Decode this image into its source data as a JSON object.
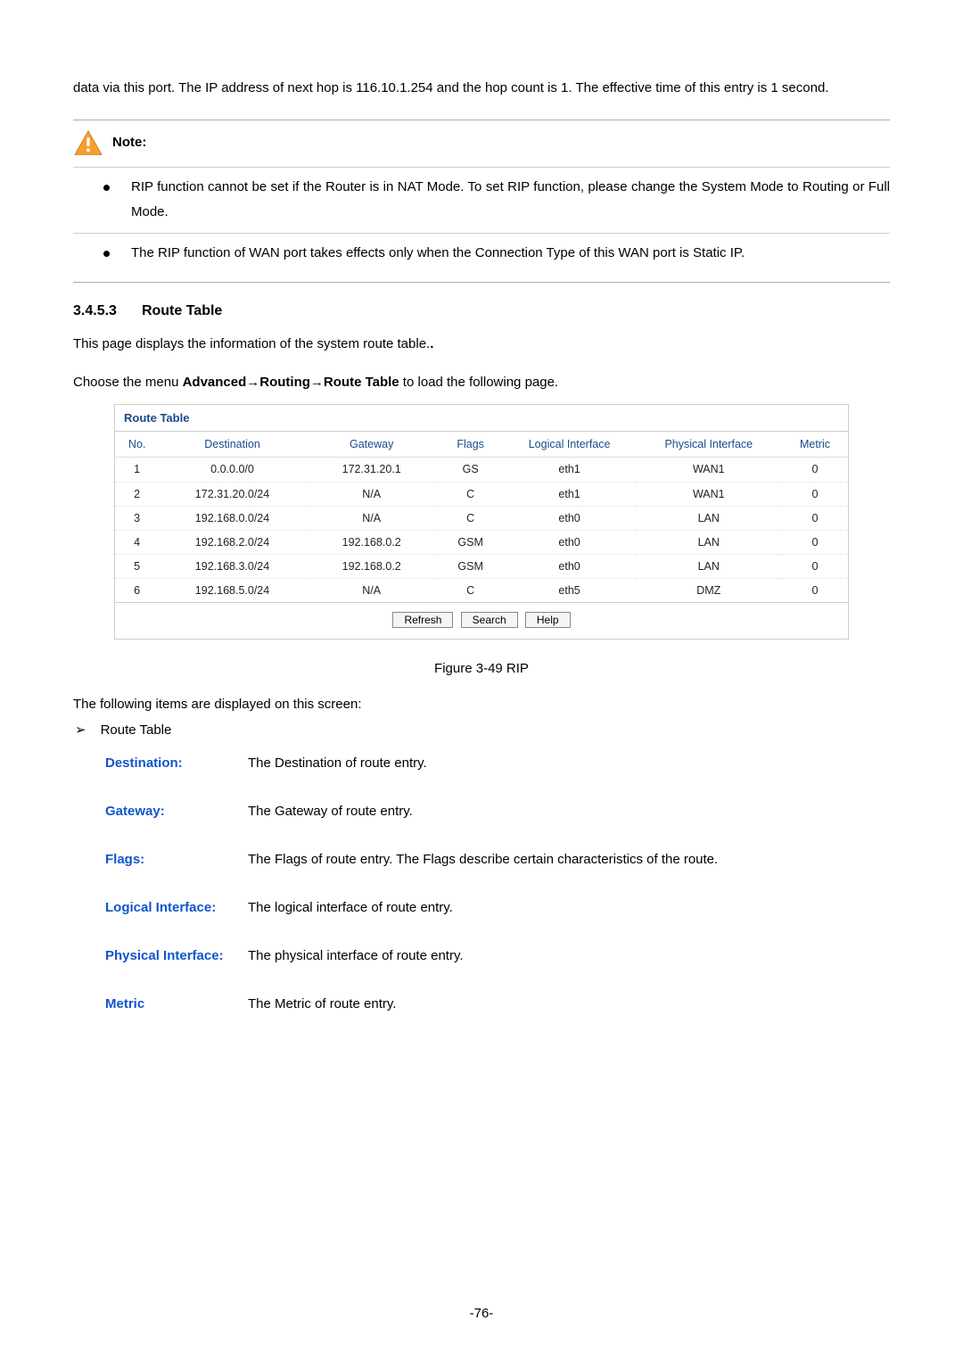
{
  "intro": "data via this port. The IP address of next hop is 116.10.1.254 and the hop count is 1. The effective time of this entry is 1 second.",
  "note": {
    "label": "Note:",
    "items": [
      "RIP function cannot be set if the Router is in NAT Mode. To set RIP function, please change the System Mode to Routing or Full Mode.",
      "The RIP function of WAN port takes effects only when the Connection Type of this WAN port is Static IP."
    ]
  },
  "section": {
    "num": "3.4.5.3",
    "title": "Route Table"
  },
  "body1": "This page displays the information of the system route table.",
  "menu_prefix": "Choose the menu ",
  "menu_bold": "Advanced→Routing→Route Table",
  "menu_suffix": " to load the following page.",
  "route_table": {
    "title": "Route Table",
    "headers": [
      "No.",
      "Destination",
      "Gateway",
      "Flags",
      "Logical Interface",
      "Physical Interface",
      "Metric"
    ],
    "rows": [
      [
        "1",
        "0.0.0.0/0",
        "172.31.20.1",
        "GS",
        "eth1",
        "WAN1",
        "0"
      ],
      [
        "2",
        "172.31.20.0/24",
        "N/A",
        "C",
        "eth1",
        "WAN1",
        "0"
      ],
      [
        "3",
        "192.168.0.0/24",
        "N/A",
        "C",
        "eth0",
        "LAN",
        "0"
      ],
      [
        "4",
        "192.168.2.0/24",
        "192.168.0.2",
        "GSM",
        "eth0",
        "LAN",
        "0"
      ],
      [
        "5",
        "192.168.3.0/24",
        "192.168.0.2",
        "GSM",
        "eth0",
        "LAN",
        "0"
      ],
      [
        "6",
        "192.168.5.0/24",
        "N/A",
        "C",
        "eth5",
        "DMZ",
        "0"
      ]
    ],
    "buttons": {
      "refresh": "Refresh",
      "search": "Search",
      "help": "Help"
    }
  },
  "figcap": "Figure 3-49 RIP",
  "disp_line": "The following items are displayed on this screen:",
  "chevron_label": "Route Table",
  "defs": [
    {
      "term": "Destination:",
      "body": "The Destination of route entry."
    },
    {
      "term": "Gateway:",
      "body": "The Gateway of route entry."
    },
    {
      "term": "Flags:",
      "body": "The Flags of route entry. The Flags describe certain characteristics of the route."
    },
    {
      "term": "Logical Interface:",
      "body": "The logical interface of route entry."
    },
    {
      "term": "Physical Interface:",
      "body": "The physical interface of route entry."
    },
    {
      "term": "Metric",
      "body": "The Metric of route entry."
    }
  ],
  "page_num": "-76-"
}
